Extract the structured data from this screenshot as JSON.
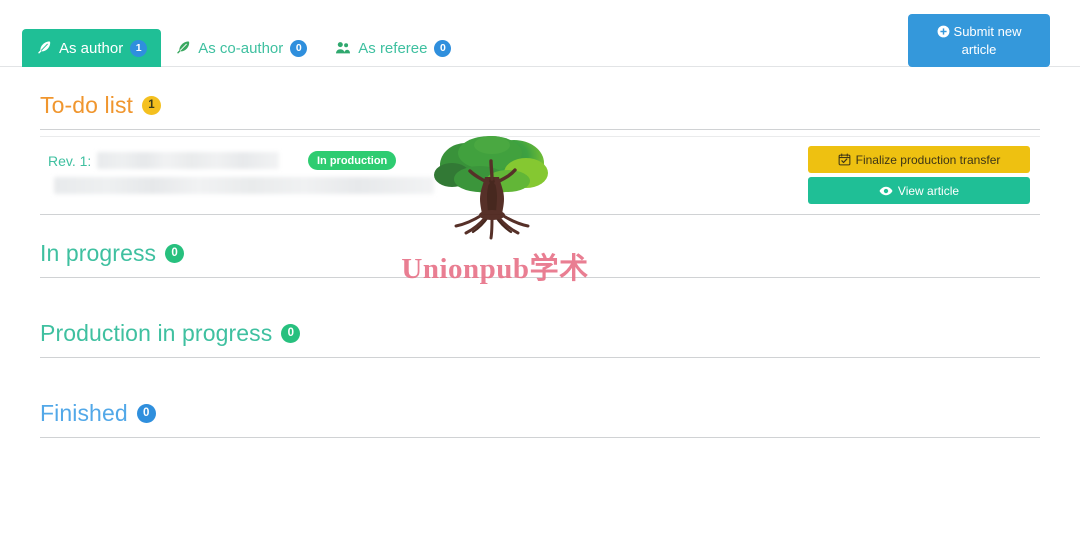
{
  "tabs": [
    {
      "label": "As author",
      "count": "1",
      "icon": "feather-icon",
      "active": true
    },
    {
      "label": "As co-author",
      "count": "0",
      "icon": "feather-icon",
      "active": false
    },
    {
      "label": "As referee",
      "count": "0",
      "icon": "referees-icon",
      "active": false
    }
  ],
  "submit": {
    "label": "Submit new article",
    "line1": "Submit new",
    "line2": "article",
    "icon": "plus-circle-icon",
    "color": "#3498db"
  },
  "sections": [
    {
      "title": "To-do list",
      "count": "1",
      "color": "#f0962e",
      "badge": "amber"
    },
    {
      "title": "In progress",
      "count": "0",
      "color": "#3fc0a0",
      "badge": "green"
    },
    {
      "title": "Production in progress",
      "count": "0",
      "color": "#3fc0a0",
      "badge": "green"
    },
    {
      "title": "Finished",
      "count": "0",
      "color": "#52a8e8",
      "badge": "blue"
    }
  ],
  "todo_row": {
    "rev_label": "Rev. 1:",
    "status": "In production",
    "status_color": "#2ecc71",
    "title_redacted": true,
    "actions": [
      {
        "label": "Finalize production transfer",
        "icon": "calendar-check-icon",
        "color": "#eec111"
      },
      {
        "label": "View article",
        "icon": "eye-icon",
        "color": "#1fbf96"
      }
    ]
  },
  "watermark": {
    "text": "Unionpub学术",
    "logo": "tree-logo",
    "text_color": "#e8758a"
  }
}
